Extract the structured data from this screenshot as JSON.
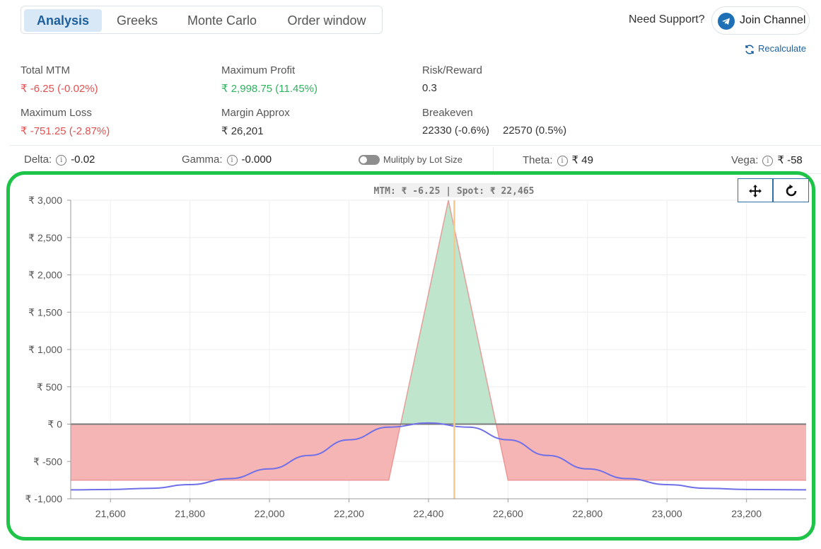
{
  "tabs": [
    {
      "label": "Analysis",
      "active": true
    },
    {
      "label": "Greeks",
      "active": false
    },
    {
      "label": "Monte Carlo",
      "active": false
    },
    {
      "label": "Order window",
      "active": false
    }
  ],
  "support": {
    "label": "Need Support?",
    "join_label": "Join Channel",
    "join_icon": "telegram-icon",
    "recalculate_label": "Recalculate",
    "recalculate_icon": "refresh-icon"
  },
  "metrics": {
    "total_mtm": {
      "label": "Total MTM",
      "value": "₹ -6.25 (-0.02%)"
    },
    "max_profit": {
      "label": "Maximum Profit",
      "value": "₹ 2,998.75 (11.45%)"
    },
    "risk_reward": {
      "label": "Risk/Reward",
      "value": "0.3"
    },
    "max_loss": {
      "label": "Maximum Loss",
      "value": "₹ -751.25 (-2.87%)"
    },
    "margin": {
      "label": "Margin Approx",
      "value": "₹ 26,201"
    },
    "breakeven": {
      "label": "Breakeven",
      "value_1": "22330 (-0.6%)",
      "value_2": "22570 (0.5%)"
    }
  },
  "greeks": {
    "delta": {
      "label": "Delta:",
      "value": "-0.02"
    },
    "gamma": {
      "label": "Gamma:",
      "value": "-0.000"
    },
    "lot_toggle_label": "Mulitply by Lot Size",
    "theta": {
      "label": "Theta:",
      "value": "₹ 49"
    },
    "vega": {
      "label": "Vega:",
      "value": "₹ -58"
    },
    "info_icon": "info-icon"
  },
  "chart_tools": {
    "pan_icon": "move-icon",
    "reset_icon": "reset-icon"
  },
  "colors": {
    "accent": "#1d5f9c",
    "profit": "#2fb35f",
    "loss": "#e05252",
    "frame": "#1dc447",
    "profit_fill": "#bfe6cc",
    "loss_fill": "#f5b5b5",
    "projection_line": "#6f6fe8",
    "spot_line": "#f5c98a"
  },
  "chart_data": {
    "type": "area",
    "tooltip": "MTM: ₹ -6.25  |  Spot: ₹ 22,465",
    "spot": 22465,
    "xlim": [
      21500,
      23350
    ],
    "ylim": [
      -1000,
      3000
    ],
    "x_ticks": [
      21600,
      21800,
      22000,
      22200,
      22400,
      22600,
      22800,
      23000,
      23200
    ],
    "x_tick_labels": [
      "21,600",
      "21,800",
      "22,000",
      "22,200",
      "22,400",
      "22,600",
      "22,800",
      "23,000",
      "23,200"
    ],
    "y_ticks": [
      3000,
      2500,
      2000,
      1500,
      1000,
      500,
      0,
      -500,
      -1000
    ],
    "y_tick_labels": [
      "₹ 3,000",
      "₹ 2,500",
      "₹ 2,000",
      "₹ 1,500",
      "₹ 1,000",
      "₹ 500",
      "₹ 0",
      "₹ -500",
      "₹ -1,000"
    ],
    "grid": true,
    "series": [
      {
        "points": [
          [
            21500,
            -751.25
          ],
          [
            22300,
            -751.25
          ],
          [
            22330,
            0
          ],
          [
            22450,
            2998.75
          ],
          [
            22570,
            0
          ],
          [
            22600,
            -751.25
          ],
          [
            23350,
            -751.25
          ]
        ]
      },
      {
        "points": [
          [
            21500,
            -880
          ],
          [
            21600,
            -875
          ],
          [
            21700,
            -860
          ],
          [
            21800,
            -810
          ],
          [
            21900,
            -730
          ],
          [
            22000,
            -600
          ],
          [
            22100,
            -420
          ],
          [
            22200,
            -210
          ],
          [
            22300,
            -40
          ],
          [
            22400,
            15
          ],
          [
            22500,
            -40
          ],
          [
            22600,
            -210
          ],
          [
            22700,
            -420
          ],
          [
            22800,
            -600
          ],
          [
            22900,
            -730
          ],
          [
            23000,
            -810
          ],
          [
            23100,
            -860
          ],
          [
            23200,
            -875
          ],
          [
            23350,
            -880
          ]
        ]
      }
    ]
  }
}
